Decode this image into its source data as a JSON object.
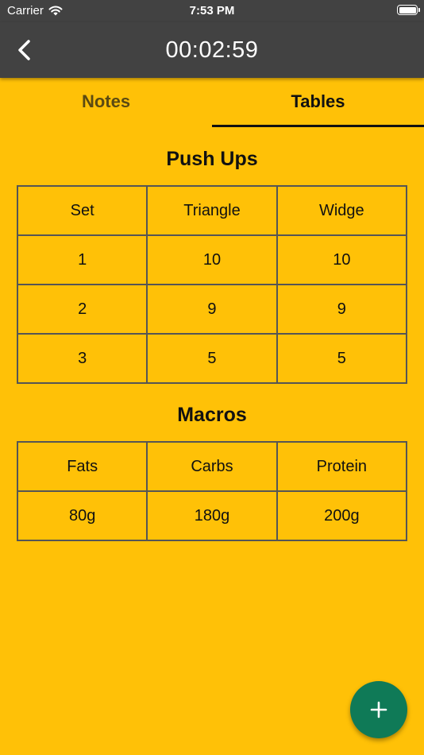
{
  "status_bar": {
    "carrier": "Carrier",
    "time": "7:53 PM",
    "wifi_icon": "wifi-icon",
    "battery_icon": "battery-icon"
  },
  "app_bar": {
    "back_icon": "chevron-left-icon",
    "title": "00:02:59"
  },
  "tabs": [
    {
      "label": "Notes",
      "selected": false
    },
    {
      "label": "Tables",
      "selected": true
    }
  ],
  "tables": [
    {
      "title": "Push Ups",
      "rows": [
        [
          "Set",
          "Triangle",
          "Widge"
        ],
        [
          "1",
          "10",
          "10"
        ],
        [
          "2",
          "9",
          "9"
        ],
        [
          "3",
          "5",
          "5"
        ]
      ]
    },
    {
      "title": "Macros",
      "rows": [
        [
          "Fats",
          "Carbs",
          "Protein"
        ],
        [
          "80g",
          "180g",
          "200g"
        ]
      ]
    }
  ],
  "fab": {
    "icon": "plus-icon"
  },
  "colors": {
    "background": "#FFC107",
    "app_bar": "#424242",
    "fab": "#0F7A57",
    "table_border": "#555555"
  }
}
